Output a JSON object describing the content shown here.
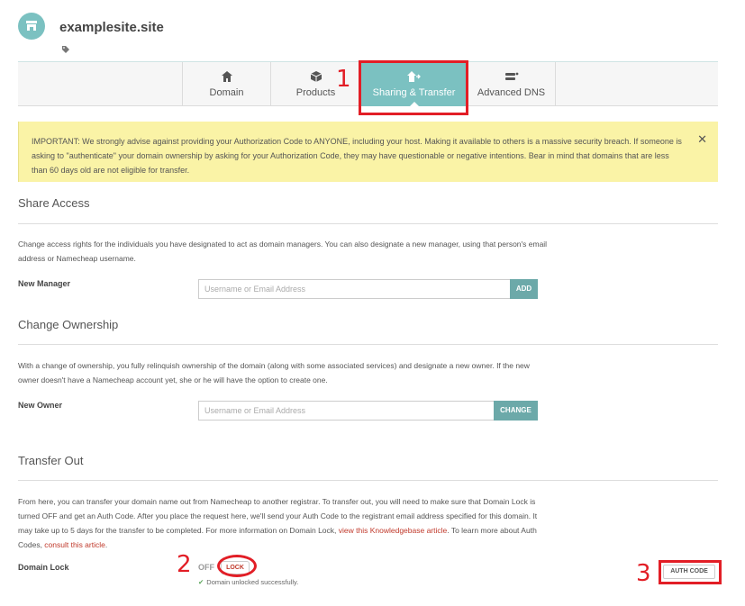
{
  "site": {
    "title": "examplesite.site"
  },
  "tabs": [
    {
      "label": "Domain",
      "icon": "home-icon"
    },
    {
      "label": "Products",
      "icon": "box-icon"
    },
    {
      "label": "Sharing & Transfer",
      "icon": "transfer-icon",
      "active": true
    },
    {
      "label": "Advanced DNS",
      "icon": "server-icon"
    }
  ],
  "annotations": {
    "a1": "1",
    "a2": "2",
    "a3": "3"
  },
  "alert": {
    "text": "IMPORTANT: We strongly advise against providing your Authorization Code to ANYONE, including your host. Making it available to others is a massive security breach. If someone is asking to \"authenticate\" your domain ownership by asking for your Authorization Code, they may have questionable or negative intentions. Bear in mind that domains that are less than 60 days old are not eligible for transfer.",
    "close": "✕"
  },
  "share": {
    "title": "Share Access",
    "text": "Change access rights for the individuals you have designated to act as domain managers. You can also designate a new manager, using that person's email address or Namecheap username.",
    "label": "New Manager",
    "placeholder": "Username or Email Address",
    "button": "ADD"
  },
  "ownership": {
    "title": "Change Ownership",
    "text": "With a change of ownership, you fully relinquish ownership of the domain (along with some associated services) and designate a new owner. If the new owner doesn't have a Namecheap account yet, she or he will have the option to create one.",
    "label": "New Owner",
    "placeholder": "Username or Email Address",
    "button": "CHANGE"
  },
  "transfer": {
    "title": "Transfer Out",
    "text_1": "From here, you can transfer your domain name out from Namecheap to another registrar. To transfer out, you will need to make sure that Domain Lock is turned OFF and get an Auth Code. After you place the request here, we'll send your Auth Code to the registrant email address specified for this domain. It may take up to 5 days for the transfer to be completed. For more information on Domain Lock, ",
    "link_1": "view this Knowledgebase article",
    "text_2": ". To learn more about Auth Codes, ",
    "link_2": "consult this article",
    "text_3": ".",
    "lock_label": "Domain Lock",
    "lock_state": "OFF",
    "lock_button": "LOCK",
    "success": "Domain unlocked successfully.",
    "auth_button": "AUTH CODE"
  },
  "colors": {
    "accent": "#7bc1c1",
    "annotation": "#e21e26",
    "alert_bg": "#faf3a6"
  }
}
